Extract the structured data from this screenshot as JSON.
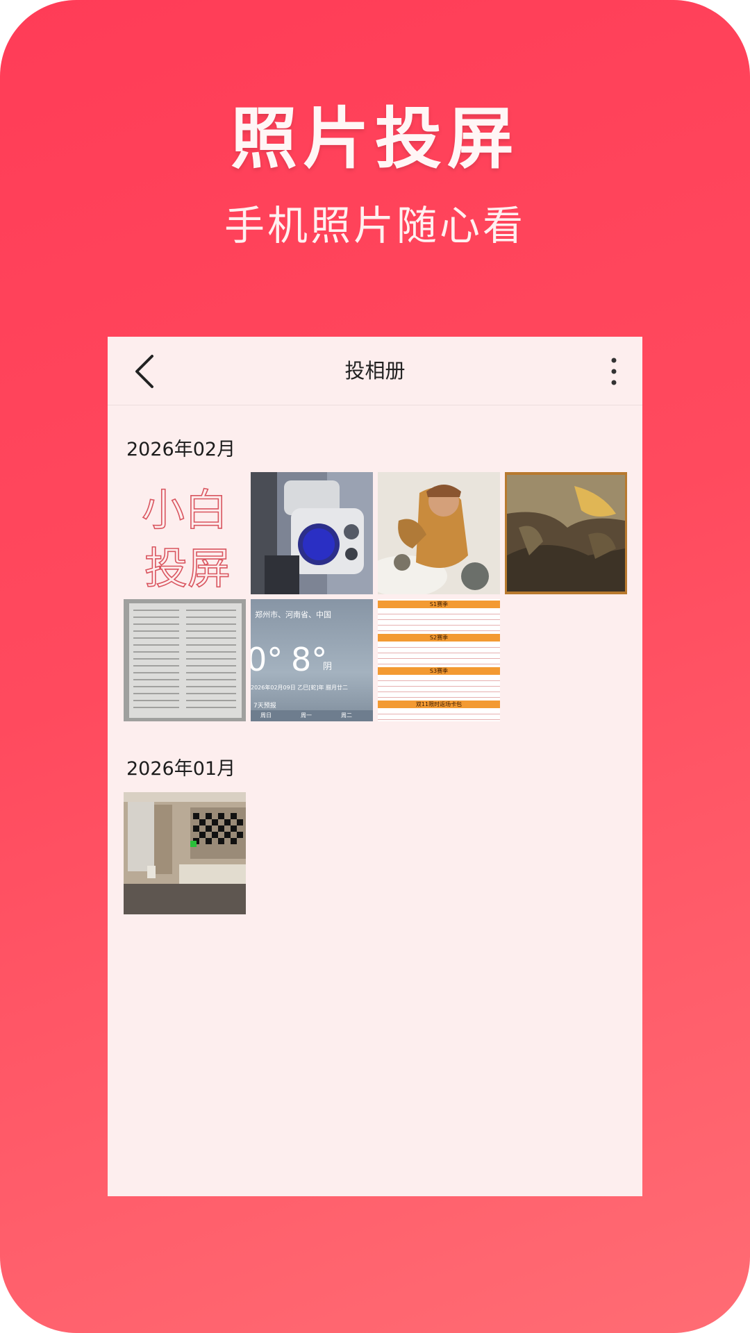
{
  "promo": {
    "headline": "照片投屏",
    "subhead": "手机照片随心看"
  },
  "toolbar": {
    "back_icon": "chevron-left-icon",
    "title": "投相册",
    "more_icon": "more-vertical-icon"
  },
  "colors": {
    "background_gradient_start": "#ff3c57",
    "background_gradient_end": "#ff6c74",
    "screen_bg": "#fdeeee"
  },
  "albums": [
    {
      "date": "2026年02月",
      "photos": [
        {
          "kind": "handwriting",
          "line1": "小白",
          "line2": "投屏"
        },
        {
          "kind": "machine"
        },
        {
          "kind": "poster"
        },
        {
          "kind": "painting"
        },
        {
          "kind": "document"
        },
        {
          "kind": "weather",
          "city": "郑州市、河南省、中国",
          "temp_left": "0°",
          "temp_right": "8°",
          "condition": "阴",
          "date_line": "2026年02月09日 乙巳[蛇]年 腊月廿二",
          "forecast": "7天预报",
          "days": [
            "周日",
            "周一",
            "周二"
          ]
        },
        {
          "kind": "schedule",
          "rows": [
            "S1赛季",
            "S2赛季",
            "S3赛季",
            "双11限时返场卡包"
          ]
        }
      ]
    },
    {
      "date": "2026年01月",
      "photos": [
        {
          "kind": "room"
        }
      ]
    }
  ]
}
